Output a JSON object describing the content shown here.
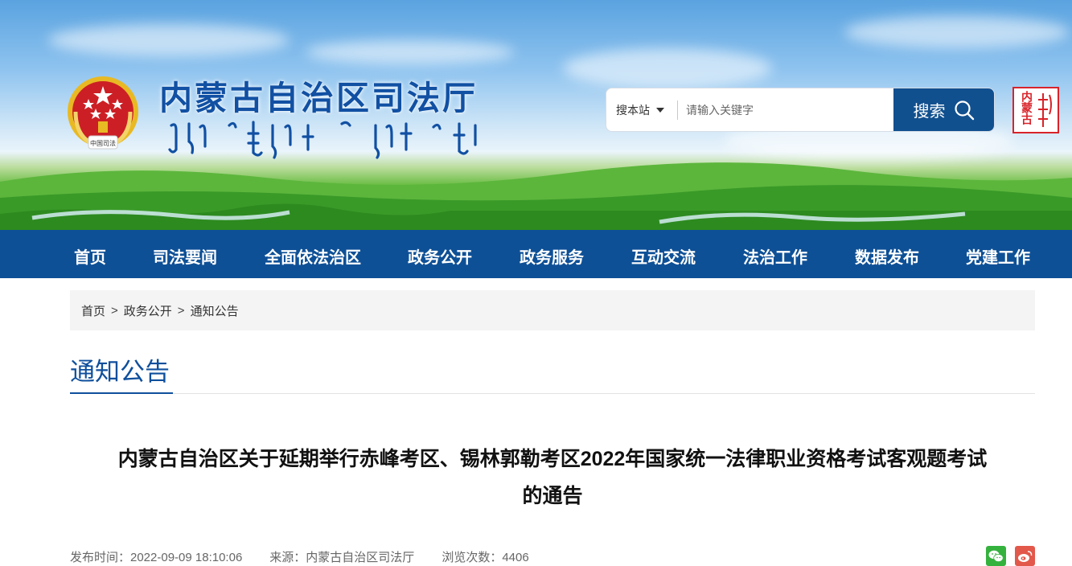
{
  "header": {
    "site_title": "内蒙古自治区司法厅",
    "emblem_text": "中国司法",
    "badge_text": "内蒙古",
    "colors": {
      "title": "#1150a3",
      "search_button": "#11508f",
      "nav": "#0e5096"
    }
  },
  "search": {
    "scope_label": "搜本站",
    "placeholder": "请输入关键字",
    "button_label": "搜索"
  },
  "nav": {
    "items": [
      {
        "label": "首页"
      },
      {
        "label": "司法要闻"
      },
      {
        "label": "全面依法治区"
      },
      {
        "label": "政务公开"
      },
      {
        "label": "政务服务"
      },
      {
        "label": "互动交流"
      },
      {
        "label": "法治工作"
      },
      {
        "label": "数据发布"
      },
      {
        "label": "党建工作"
      }
    ]
  },
  "breadcrumb": {
    "items": [
      "首页",
      "政务公开",
      "通知公告"
    ],
    "separator": ">"
  },
  "section": {
    "title": "通知公告"
  },
  "article": {
    "title_line1": "内蒙古自治区关于延期举行赤峰考区、锡林郭勒考区2022年国家统一法律职业资格考试客观题考试",
    "title_line2": "的通告",
    "published": "发布时间：2022-09-09 18:10:06",
    "source": "来源：内蒙古自治区司法厅",
    "views": "浏览次数：4406"
  },
  "share": {
    "icons": [
      "wechat-icon",
      "weibo-icon"
    ]
  }
}
